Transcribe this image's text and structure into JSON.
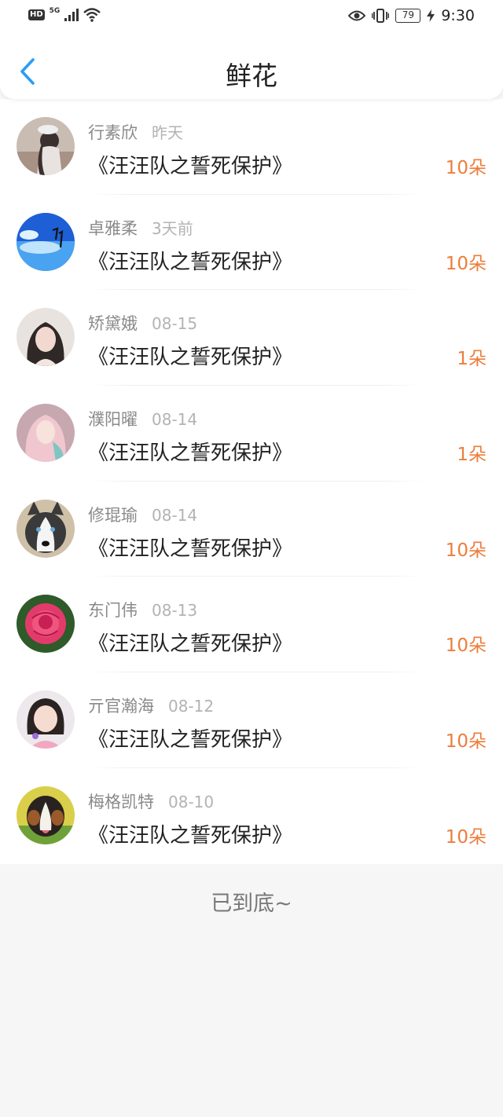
{
  "status_bar": {
    "hd": "HD",
    "network": "5G",
    "battery": "79",
    "time": "9:30"
  },
  "header": {
    "title": "鲜花"
  },
  "items": [
    {
      "name": "行素欣",
      "date": "昨天",
      "book": "《汪汪队之誓死保护》",
      "count": "10朵"
    },
    {
      "name": "卓雅柔",
      "date": "3天前",
      "book": "《汪汪队之誓死保护》",
      "count": "10朵"
    },
    {
      "name": "矫黛娥",
      "date": "08-15",
      "book": "《汪汪队之誓死保护》",
      "count": "1朵"
    },
    {
      "name": "濮阳曜",
      "date": "08-14",
      "book": "《汪汪队之誓死保护》",
      "count": "1朵"
    },
    {
      "name": "修琨瑜",
      "date": "08-14",
      "book": "《汪汪队之誓死保护》",
      "count": "10朵"
    },
    {
      "name": "东门伟",
      "date": "08-13",
      "book": "《汪汪队之誓死保护》",
      "count": "10朵"
    },
    {
      "name": "亓官瀚海",
      "date": "08-12",
      "book": "《汪汪队之誓死保护》",
      "count": "10朵"
    },
    {
      "name": "梅格凯特",
      "date": "08-10",
      "book": "《汪汪队之誓死保护》",
      "count": "10朵"
    }
  ],
  "footer": {
    "text": "已到底~"
  },
  "colors": {
    "accent": "#2a9df4",
    "count": "#ec7d3b"
  }
}
